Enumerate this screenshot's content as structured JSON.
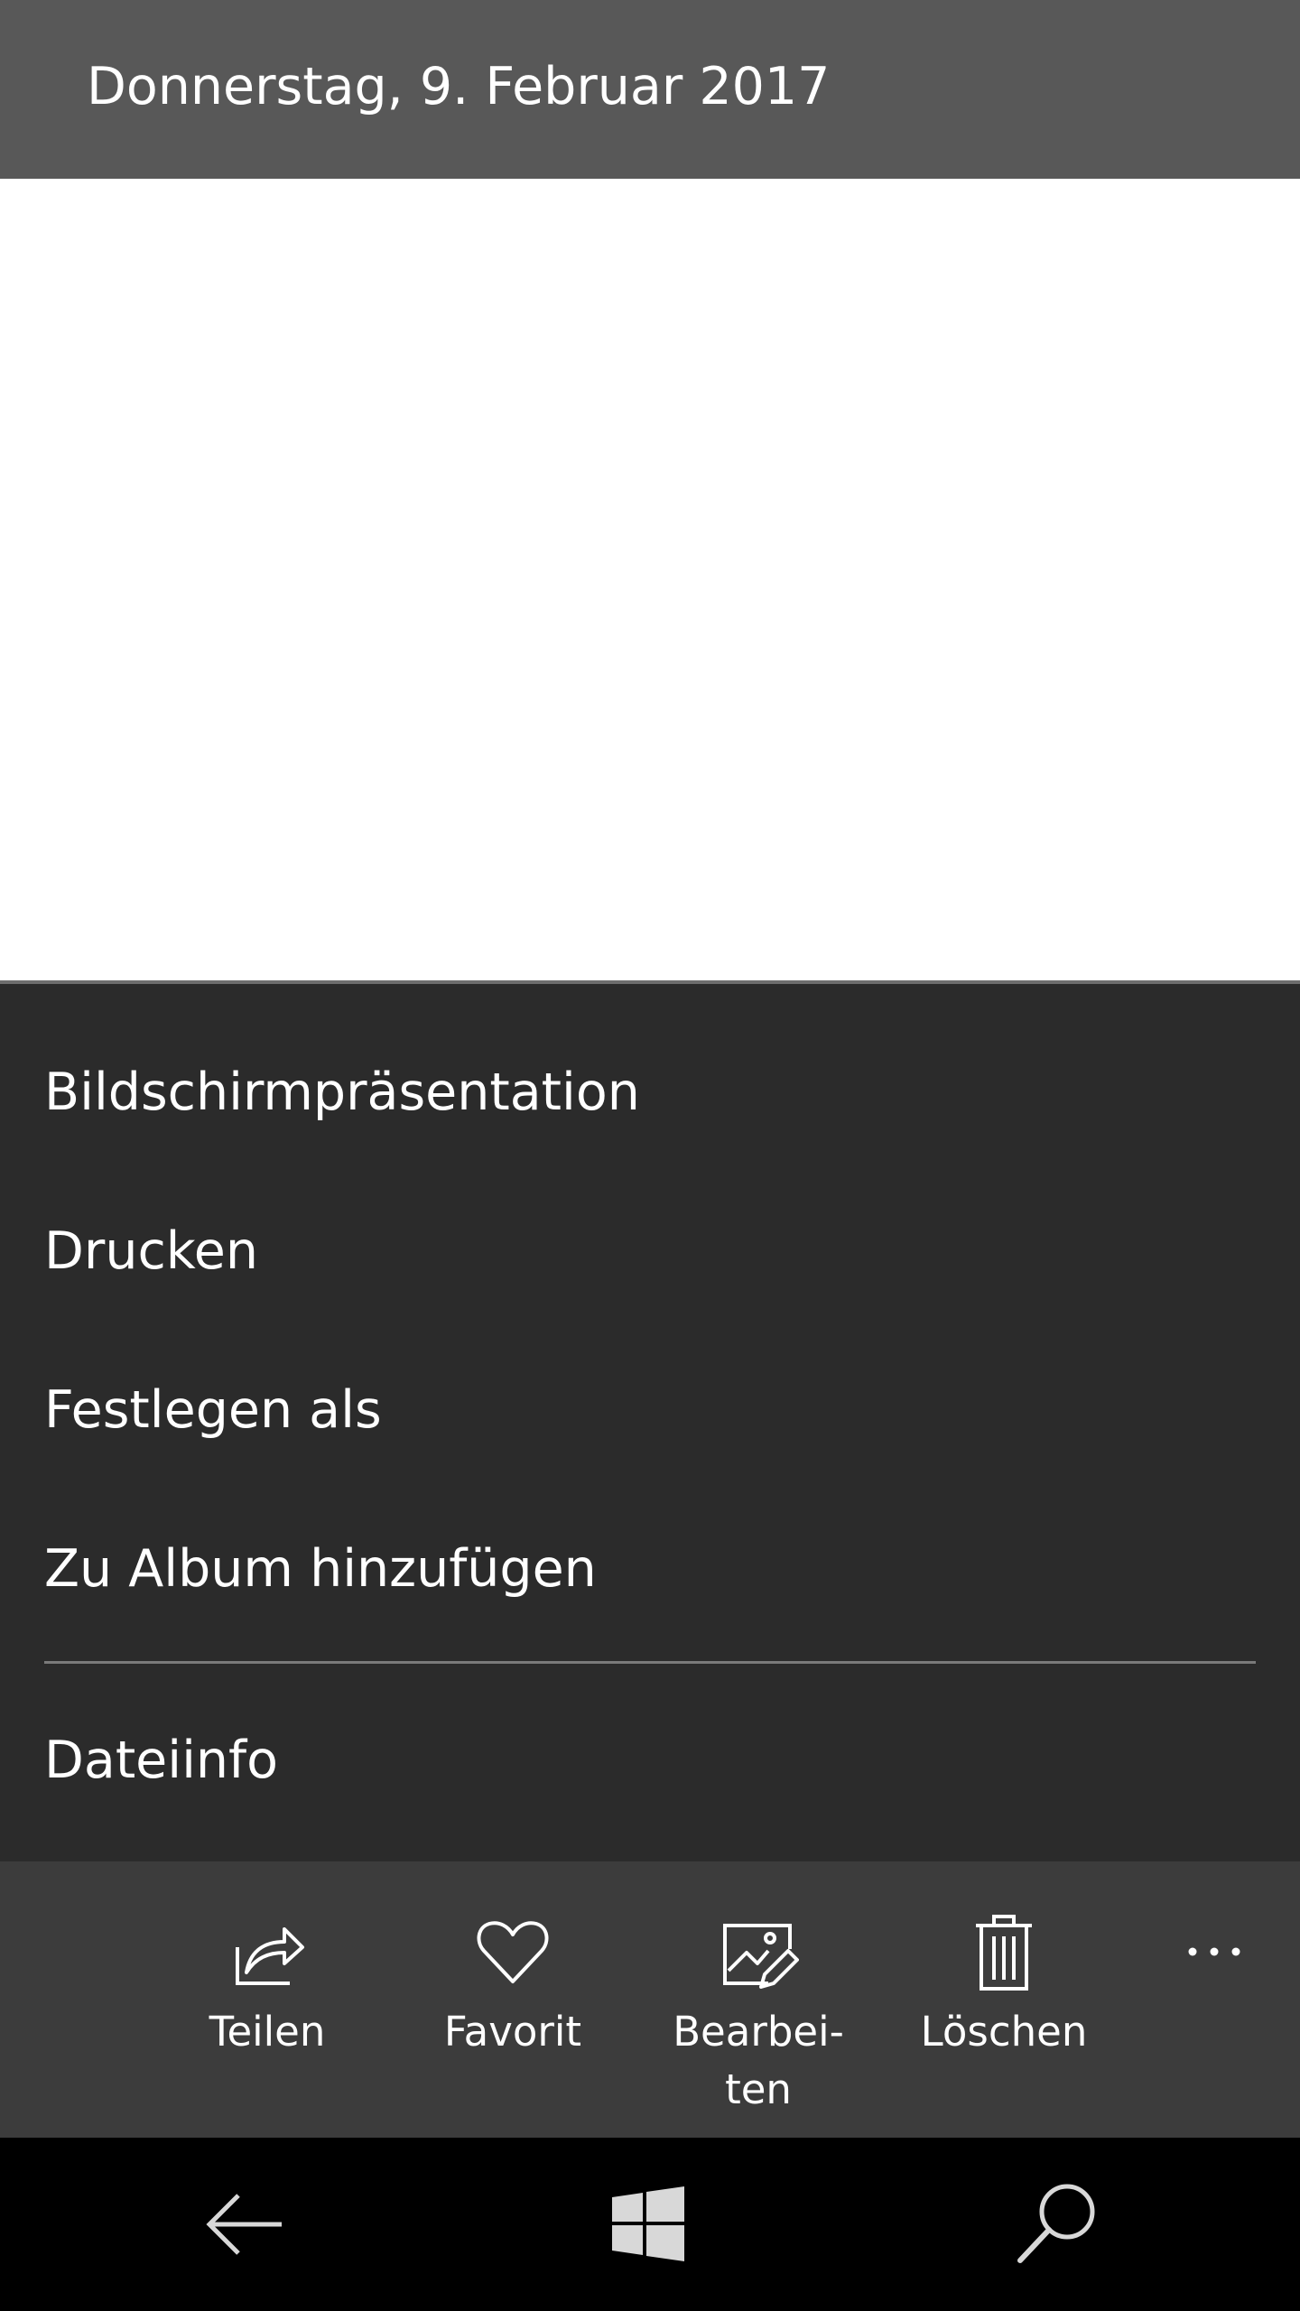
{
  "header": {
    "title": "Donnerstag, 9. Februar 2017"
  },
  "menu": {
    "items": [
      {
        "label": "Bildschirmpräsentation"
      },
      {
        "label": "Drucken"
      },
      {
        "label": "Festlegen als"
      },
      {
        "label": "Zu Album hinzufügen"
      },
      {
        "label": "Dateiinfo"
      }
    ]
  },
  "appbar": {
    "buttons": [
      {
        "label": "Teilen",
        "icon": "share-icon"
      },
      {
        "label": "Favorit",
        "icon": "heart-icon"
      },
      {
        "label": "Bearbei-\nten",
        "icon": "edit-image-icon"
      },
      {
        "label": "Löschen",
        "icon": "trash-icon"
      }
    ],
    "more_icon": "more-icon"
  },
  "navbar": {
    "icons": [
      "back-arrow-icon",
      "windows-icon",
      "search-icon"
    ]
  },
  "colors": {
    "header_bg": "#585858",
    "menu_bg": "#2b2b2b",
    "appbar_bg": "#3c3c3c",
    "navbar_bg": "#000000"
  }
}
